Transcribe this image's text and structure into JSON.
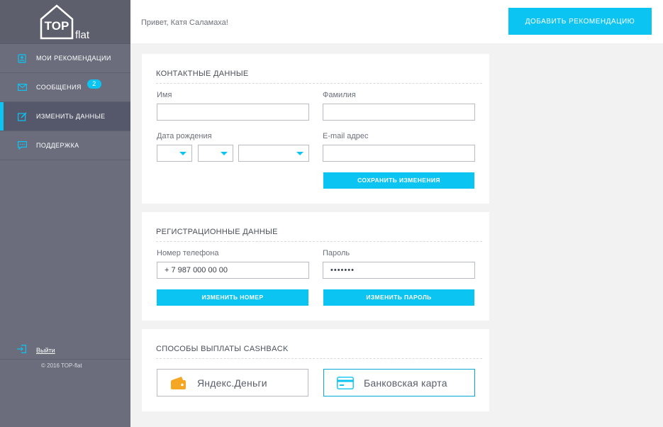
{
  "sidebar": {
    "logo_text_top": "TOP",
    "logo_text_bottom": "flat",
    "items": [
      {
        "label": "Мои рекомендации",
        "icon": "contacts-icon"
      },
      {
        "label": "Сообщения",
        "icon": "envelope-icon",
        "badge": "2"
      },
      {
        "label": "Изменить данные",
        "icon": "edit-icon",
        "active": true
      },
      {
        "label": "Поддержка",
        "icon": "chat-icon"
      }
    ],
    "logout_label": "Выйти",
    "copyright": "© 2016 TOP-flat"
  },
  "topbar": {
    "greeting": "Привет, Катя Саламаха!",
    "add_button": "Добавить рекомендацию"
  },
  "contact": {
    "title": "Контактные данные",
    "first_name_label": "Имя",
    "first_name_value": "",
    "last_name_label": "Фамилия",
    "last_name_value": "",
    "birth_label": "Дата рождения",
    "email_label": "E-mail адрес",
    "email_value": "",
    "save_button": "Сохранить изменения"
  },
  "registration": {
    "title": "Регистрационные данные",
    "phone_label": "Номер телефона",
    "phone_value": "+ 7 987 000 00 00",
    "password_label": "Пароль",
    "password_value": "•••••••",
    "change_phone_button": "Изменить номер",
    "change_password_button": "Изменить пароль"
  },
  "cashback": {
    "title": "Способы выплаты CASHBACK",
    "options": [
      {
        "label": "Яндекс.Деньги",
        "icon": "wallet-icon"
      },
      {
        "label": "Банковская карта",
        "icon": "credit-card-icon",
        "selected": true
      }
    ]
  },
  "colors": {
    "accent": "#0bc4f2",
    "sidebar": "#6b6d7c",
    "yandex_icon": "#f5a623"
  }
}
